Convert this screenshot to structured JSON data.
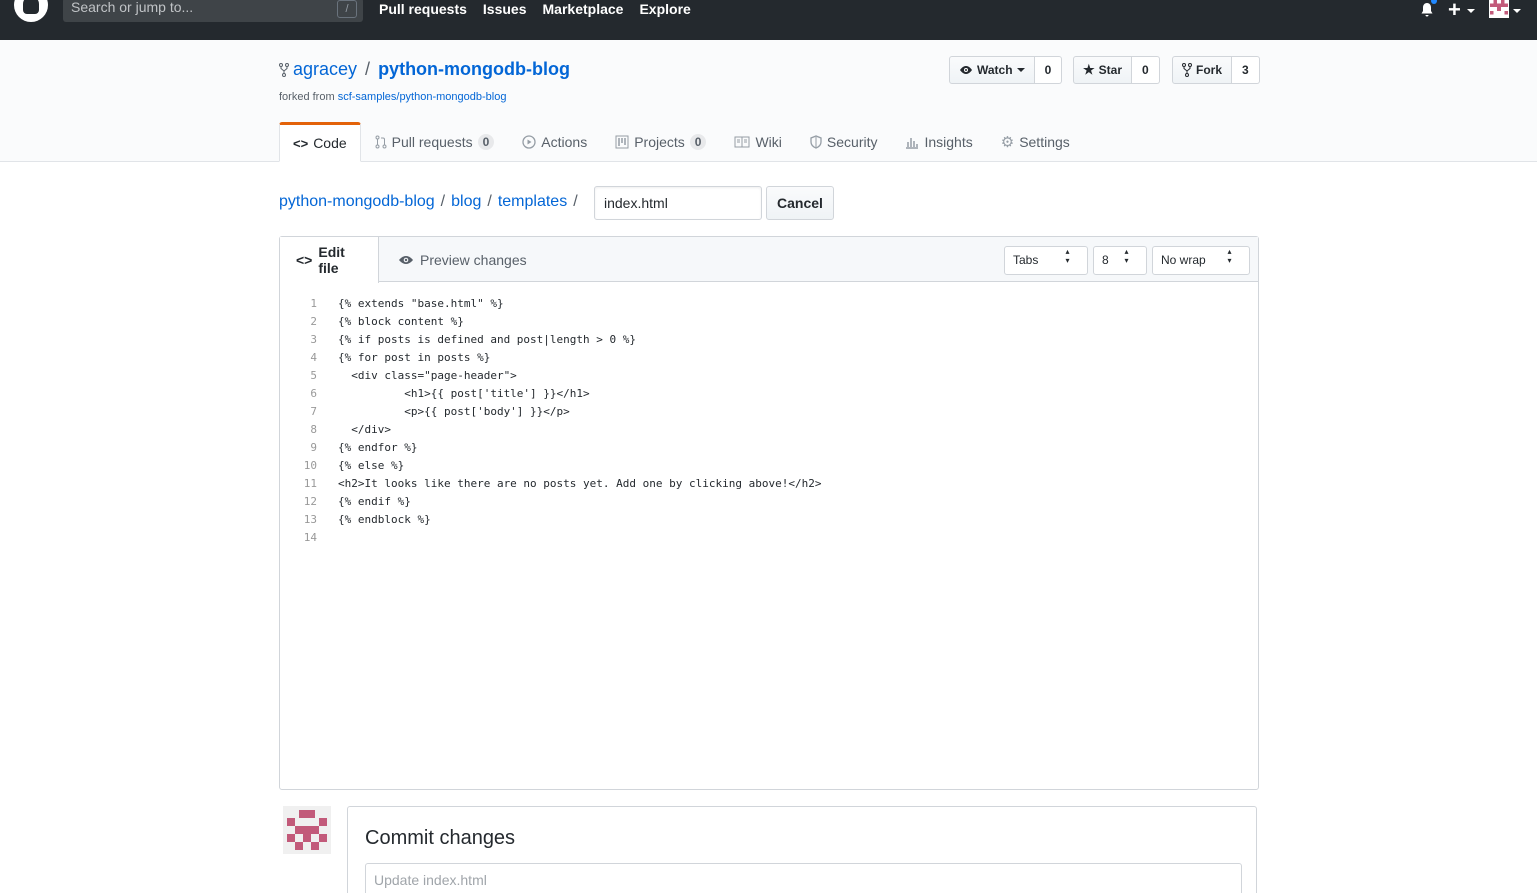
{
  "topbar": {
    "search_placeholder": "Search or jump to...",
    "slash_key": "/",
    "nav": [
      "Pull requests",
      "Issues",
      "Marketplace",
      "Explore"
    ],
    "plus_label": "+"
  },
  "repo": {
    "owner": "agracey",
    "name": "python-mongodb-blog",
    "forked_from_label": "forked from",
    "forked_from_link": "scf-samples/python-mongodb-blog",
    "watch_label": "Watch",
    "watch_count": "0",
    "star_label": "Star",
    "star_count": "0",
    "fork_label": "Fork",
    "fork_count": "3"
  },
  "tabs": [
    {
      "label": "Code",
      "counter": "",
      "icon": "code-icon"
    },
    {
      "label": "Pull requests",
      "counter": "0",
      "icon": "pull-request-icon"
    },
    {
      "label": "Actions",
      "counter": "",
      "icon": "play-icon"
    },
    {
      "label": "Projects",
      "counter": "0",
      "icon": "project-icon"
    },
    {
      "label": "Wiki",
      "counter": "",
      "icon": "book-icon"
    },
    {
      "label": "Security",
      "counter": "",
      "icon": "shield-icon"
    },
    {
      "label": "Insights",
      "counter": "",
      "icon": "graph-icon"
    },
    {
      "label": "Settings",
      "counter": "",
      "icon": "gear-icon"
    }
  ],
  "breadcrumb": {
    "repo": "python-mongodb-blog",
    "dir1": "blog",
    "dir2": "templates",
    "separator": "/",
    "filename": "index.html",
    "cancel_label": "Cancel"
  },
  "editor": {
    "edit_tab": "Edit file",
    "preview_tab": "Preview changes",
    "indent_mode": "Tabs",
    "indent_size": "8",
    "wrap_mode": "No wrap",
    "lines": [
      "{% extends \"base.html\" %}",
      "{% block content %}",
      "{% if posts is defined and post|length > 0 %}",
      "{% for post in posts %}",
      "  <div class=\"page-header\">",
      "          <h1>{{ post['title'] }}</h1>",
      "          <p>{{ post['body'] }}</p>",
      "  </div>",
      "{% endfor %}",
      "{% else %}",
      "<h2>It looks like there are no posts yet. Add one by clicking above!</h2>",
      "{% endif %}",
      "{% endblock %}",
      ""
    ],
    "line_numbers": [
      "1",
      "2",
      "3",
      "4",
      "5",
      "6",
      "7",
      "8",
      "9",
      "10",
      "11",
      "12",
      "13",
      "14"
    ]
  },
  "commit": {
    "title": "Commit changes",
    "message_placeholder": "Update index.html"
  },
  "colors": {
    "header_bg": "#24292e",
    "link": "#0366d6",
    "tab_accent": "#e36209",
    "avatar_identicon": "#c25a7a"
  }
}
